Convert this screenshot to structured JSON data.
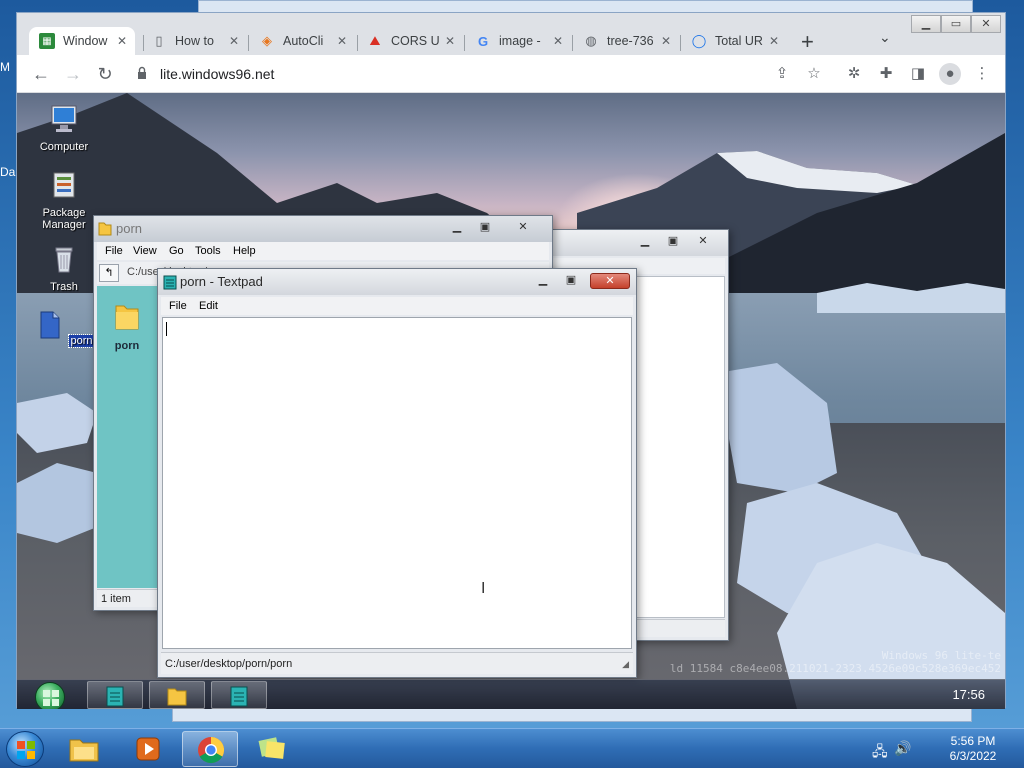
{
  "host": {
    "side_labels": [
      "M",
      "Da"
    ],
    "taskbar": {
      "time": "5:56 PM",
      "date": "6/3/2022",
      "apps": [
        {
          "name": "File Explorer",
          "icon": "folder-icon"
        },
        {
          "name": "Media Player",
          "icon": "media-player-icon"
        },
        {
          "name": "Google Chrome",
          "icon": "chrome-icon"
        },
        {
          "name": "Sticky Notes",
          "icon": "sticky-notes-icon"
        }
      ]
    }
  },
  "browser": {
    "tabs": [
      {
        "title": "Window",
        "icon": "windows96-icon",
        "active": true
      },
      {
        "title": "How to",
        "icon": "mouse-icon"
      },
      {
        "title": "AutoCli",
        "icon": "autoclicker-icon"
      },
      {
        "title": "CORS U",
        "icon": "cors-icon"
      },
      {
        "title": "image -",
        "icon": "google-icon"
      },
      {
        "title": "tree-736",
        "icon": "globe-icon"
      },
      {
        "title": "Total UR",
        "icon": "circle-icon"
      }
    ],
    "new_tab": "+",
    "url": "lite.windows96.net"
  },
  "win96": {
    "desktop_icons": [
      {
        "label": "Computer",
        "icon": "computer-icon"
      },
      {
        "label": "Package Manager",
        "icon": "package-manager-icon"
      },
      {
        "label": "Trash",
        "icon": "trash-icon"
      },
      {
        "label": "porn",
        "icon": "file-icon",
        "selected": true
      }
    ],
    "explorer": {
      "title": "porn",
      "menu": [
        "File",
        "View",
        "Go",
        "Tools",
        "Help"
      ],
      "path": "C:/user/desktop/porn",
      "folder_label": "porn",
      "status": "1 item"
    },
    "textpad": {
      "title": "porn - Textpad",
      "menu": [
        "File",
        "Edit"
      ],
      "content": "",
      "status": "C:/user/desktop/porn/porn"
    },
    "taskbar": {
      "clock": "17:56",
      "tasks": [
        {
          "icon": "textpad-icon"
        },
        {
          "icon": "folder-icon"
        },
        {
          "icon": "textpad-icon"
        }
      ]
    },
    "watermark": [
      "Windows 96 lite-te",
      "ld 11584 c8e4ee08.211021-2323.4526e09c528e369ec452"
    ]
  },
  "colors": {
    "chrome_tabstrip": "#dee1e6",
    "win96_selection": "#1b3fa8",
    "close_red": "#c4412c"
  }
}
